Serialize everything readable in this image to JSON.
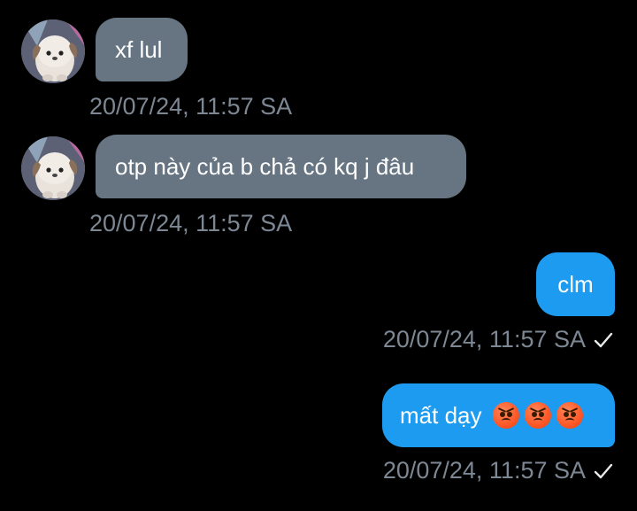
{
  "conversation": {
    "messages": [
      {
        "direction": "in",
        "text": "xf lul",
        "timestamp": "20/07/24, 11:57 SA"
      },
      {
        "direction": "in",
        "text": "otp này của b chả có kq j đâu",
        "timestamp": "20/07/24, 11:57 SA"
      },
      {
        "direction": "out",
        "text": "clm",
        "timestamp": "20/07/24, 11:57 SA",
        "status": "sent"
      },
      {
        "direction": "out",
        "text": "mất dạy",
        "emoji": "😡😡😡",
        "timestamp": "20/07/24, 11:57 SA",
        "status": "sent"
      }
    ]
  },
  "icons": {
    "avatar": "dog-avatar-icon",
    "sent": "checkmark-icon",
    "emoji": "angry-face-icon"
  },
  "colors": {
    "background": "#000000",
    "incoming_bubble": "#677481",
    "outgoing_bubble": "#1d9bf0",
    "timestamp": "#7d8894"
  }
}
